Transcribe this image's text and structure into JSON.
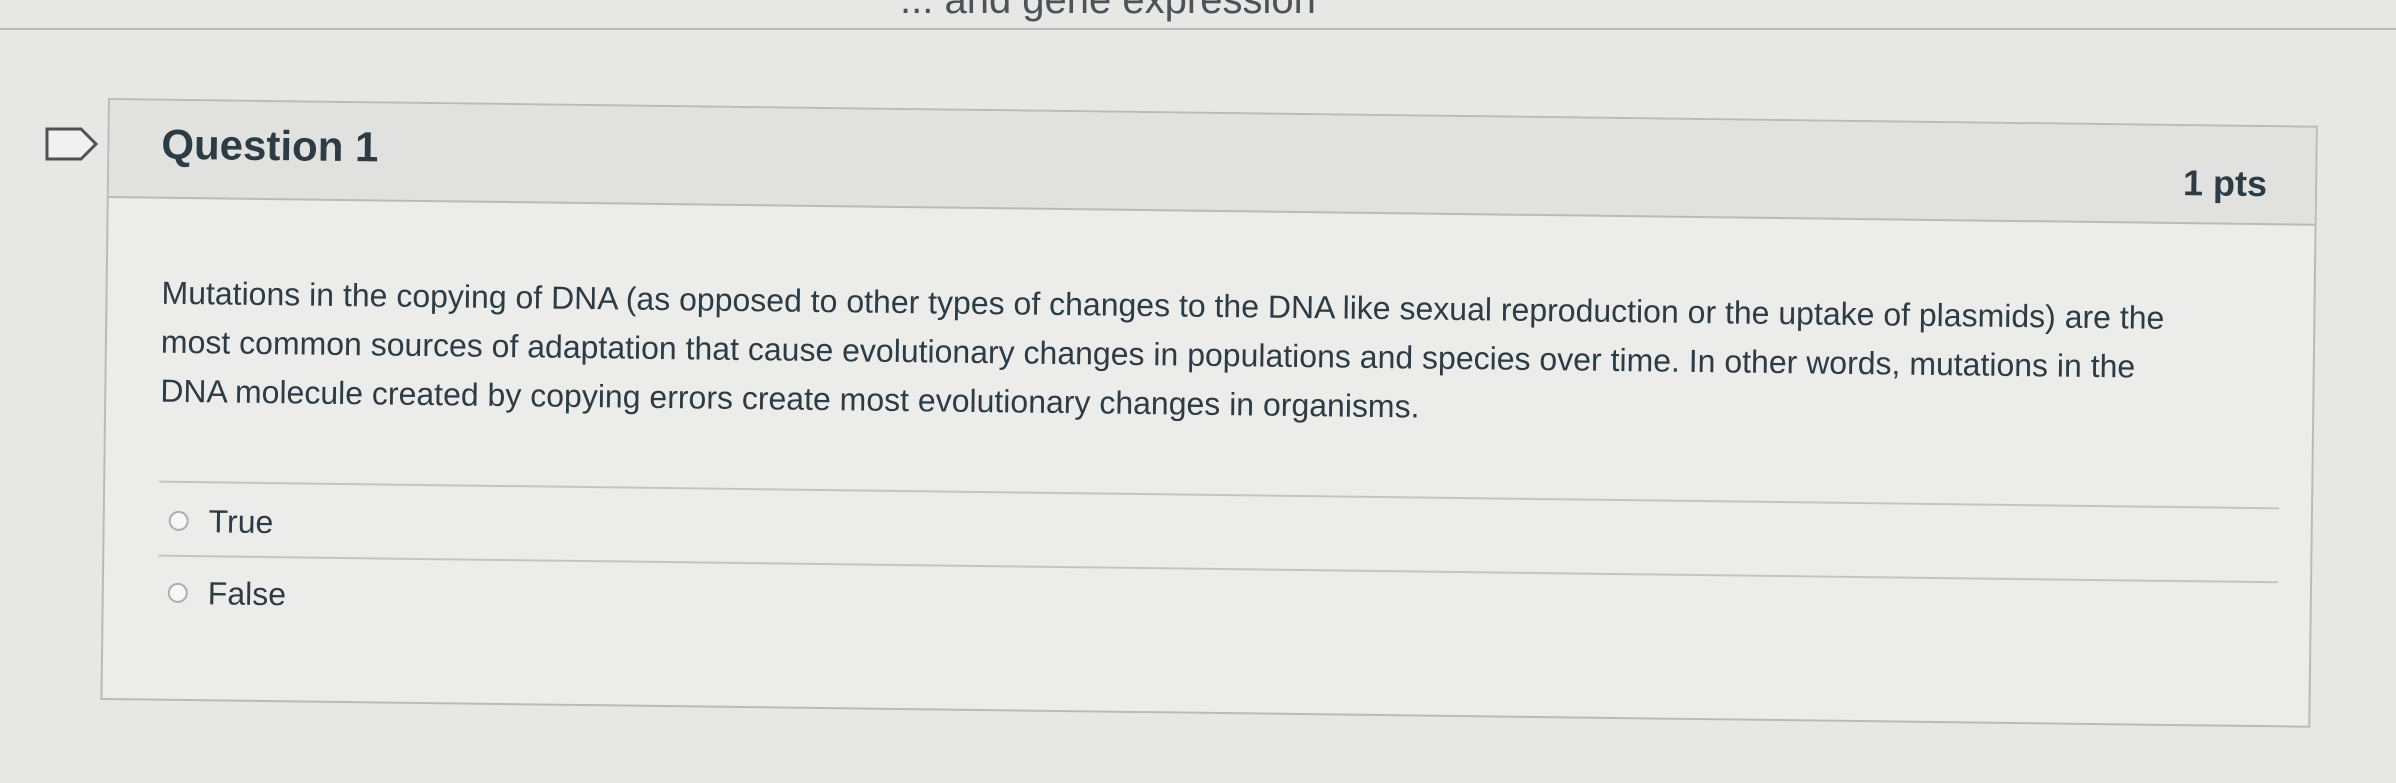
{
  "page": {
    "top_fragment": "... and gene expression"
  },
  "icons": {
    "flag": "flag-outline-icon",
    "radio": "radio-unselected-icon"
  },
  "question": {
    "title": "Question 1",
    "points": "1 pts",
    "text": "Mutations in the copying of DNA (as opposed to other types of changes to the DNA like sexual reproduction or the uptake of plasmids) are the most common sources of adaptation that cause evolutionary changes in populations and species over time. In other words, mutations in the DNA molecule created by copying errors create most evolutionary changes in organisms.",
    "answers": [
      {
        "label": "True",
        "selected": false
      },
      {
        "label": "False",
        "selected": false
      }
    ]
  },
  "colors": {
    "page_background": "#e7e7e5",
    "card_background": "#ececea",
    "header_background": "#e1e2e0",
    "text": "#2d3b45",
    "border": "#b9bbbb"
  }
}
